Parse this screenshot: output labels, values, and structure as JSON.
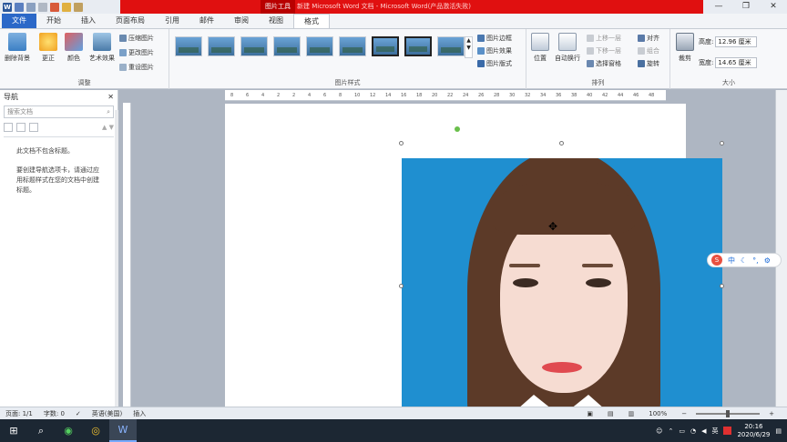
{
  "titlebar": {
    "context_tool": "图片工具",
    "doc_title": "新建 Microsoft Word 文档 - Microsoft Word(产品激活失败)",
    "buttons": [
      "—",
      "❐",
      "✕"
    ]
  },
  "tabs": [
    {
      "label": "文件",
      "kind": "file"
    },
    {
      "label": "开始",
      "kind": "normal"
    },
    {
      "label": "插入",
      "kind": "normal"
    },
    {
      "label": "页面布局",
      "kind": "normal"
    },
    {
      "label": "引用",
      "kind": "normal"
    },
    {
      "label": "邮件",
      "kind": "normal"
    },
    {
      "label": "审阅",
      "kind": "normal"
    },
    {
      "label": "视图",
      "kind": "normal"
    },
    {
      "label": "格式",
      "kind": "active"
    }
  ],
  "ribbon": {
    "adjust": {
      "label": "调整",
      "remove_bg": "删除背景",
      "corrections": "更正",
      "color": "颜色",
      "artistic": "艺术效果",
      "compress": "压缩图片",
      "change": "更改图片",
      "reset": "重设图片"
    },
    "styles": {
      "label": "图片样式",
      "border": "图片边框",
      "effects": "图片效果",
      "layout": "图片版式"
    },
    "arrange": {
      "label": "排列",
      "position": "位置",
      "wrap": "自动换行",
      "bring_forward": "上移一层",
      "send_backward": "下移一层",
      "selection_pane": "选择窗格",
      "align": "对齐",
      "group": "组合",
      "rotate": "旋转"
    },
    "size": {
      "label": "大小",
      "crop": "裁剪",
      "height_label": "高度:",
      "height_value": "12.96 厘米",
      "width_label": "宽度:",
      "width_value": "14.65 厘米"
    }
  },
  "nav": {
    "title": "导航",
    "search_placeholder": "搜索文档",
    "msg1": "此文档不包含标题。",
    "msg2": "要创建导航选项卡，请通过应用标题样式在您的文档中创建标题。"
  },
  "ruler_marks": [
    "8",
    "6",
    "4",
    "2",
    "2",
    "4",
    "6",
    "8",
    "10",
    "12",
    "14",
    "16",
    "18",
    "20",
    "22",
    "24",
    "26",
    "28",
    "30",
    "32",
    "34",
    "36",
    "38",
    "40",
    "42",
    "44",
    "46",
    "48"
  ],
  "ime": {
    "char": "中",
    "logo": "S"
  },
  "status": {
    "page": "页面: 1/1",
    "words": "字数: 0",
    "lang": "英语(美国)",
    "mode": "插入",
    "zoom": "100%"
  },
  "taskbar": {
    "time": "20:16",
    "date": "2020/6/29",
    "ime_tray": "英"
  }
}
